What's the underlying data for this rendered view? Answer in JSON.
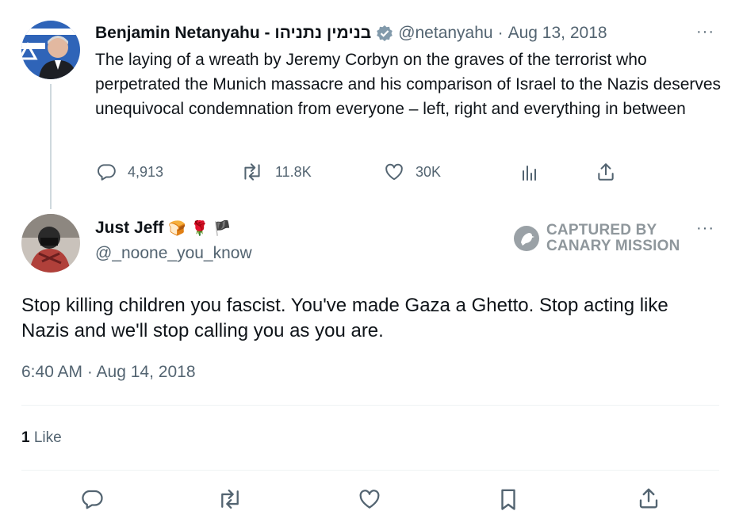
{
  "parent_tweet": {
    "name": "Benjamin Netanyahu - בנימין נתניהו",
    "handle": "@netanyahu",
    "separator": "·",
    "date": "Aug 13, 2018",
    "more": "···",
    "text": "The laying of a wreath by Jeremy Corbyn on the graves of the terrorist who perpetrated the Munich massacre and his comparison of Israel to the Nazis deserves unequivocal condemnation from everyone – left, right and everything in between",
    "actions": {
      "replies": "4,913",
      "retweets": "11.8K",
      "likes": "30K"
    }
  },
  "reply_tweet": {
    "name": "Just Jeff",
    "emojis": [
      "🍞",
      "🌹",
      "🏴"
    ],
    "handle": "@_noone_you_know",
    "more": "···",
    "text": "Stop killing children you fascist. You've made Gaza a Ghetto. Stop acting like Nazis and we'll stop calling you as you are.",
    "timestamp": "6:40 AM · Aug 14, 2018",
    "like_count": "1",
    "like_label": "Like"
  },
  "watermark": {
    "line1": "CAPTURED BY",
    "line2": "CANARY MISSION"
  },
  "colors": {
    "text": "#0f1419",
    "muted": "#536471",
    "verified": "#829aab",
    "divider": "#eff3f4",
    "watermark": "#8f979c"
  },
  "icons": [
    "verified-badge-icon",
    "reply-icon",
    "retweet-icon",
    "like-icon",
    "views-icon",
    "share-icon",
    "bookmark-icon",
    "canary-logo-icon",
    "more-icon"
  ]
}
